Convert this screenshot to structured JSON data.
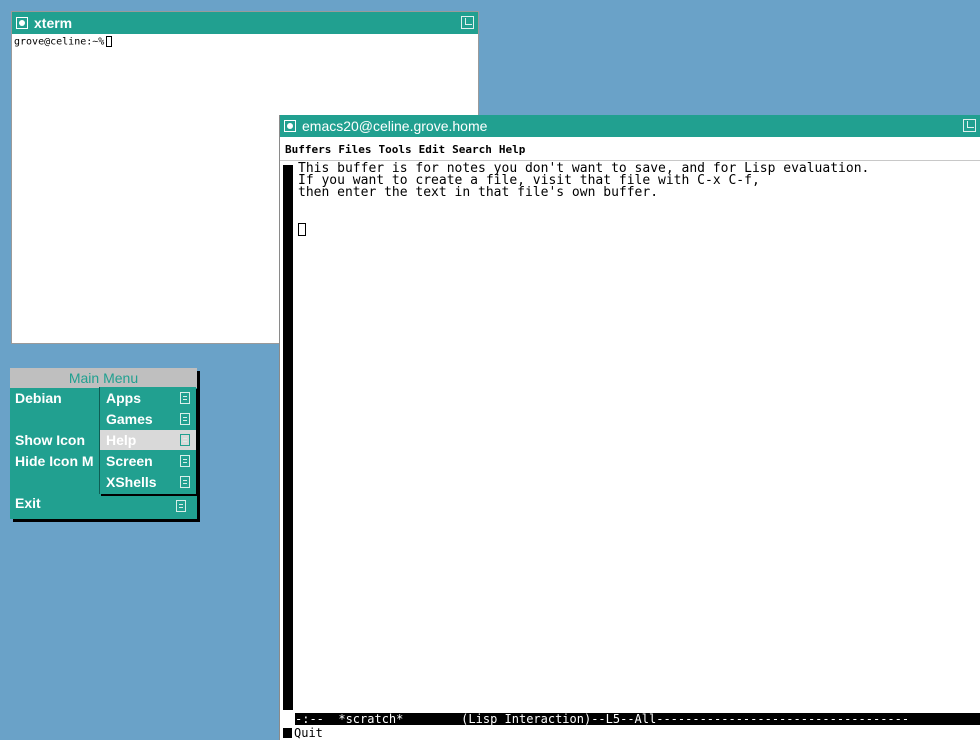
{
  "xterm": {
    "title": "xterm",
    "prompt": "grove@celine:~%"
  },
  "emacs": {
    "title": "emacs20@celine.grove.home",
    "menus": [
      "Buffers",
      "Files",
      "Tools",
      "Edit",
      "Search",
      "Help"
    ],
    "buffer_lines": [
      "This buffer is for notes you don't want to save, and for Lisp evaluation.",
      "If you want to create a file, visit that file with C-x C-f,",
      "then enter the text in that file's own buffer."
    ],
    "modeline": "-:--  *scratch*        (Lisp Interaction)--L5--All-----------------------------------",
    "minibuffer": "Quit"
  },
  "main_menu": {
    "title": "Main Menu",
    "items": [
      "Debian",
      "Show Icon",
      "Hide Icon M",
      "Exit"
    ],
    "submenu": [
      "Apps",
      "Games",
      "Help",
      "Screen",
      "XShells"
    ],
    "submenu_selected": "Help"
  },
  "colors": {
    "desktop": "#6aa2c8",
    "titlebar": "#21a090",
    "menu_bg": "#21a090",
    "menu_title_bg": "#bfbfbf"
  }
}
